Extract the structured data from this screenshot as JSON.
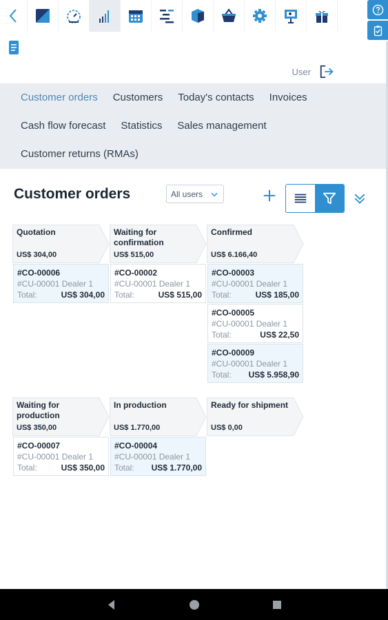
{
  "header": {
    "user_label": "User"
  },
  "nav": {
    "row1": [
      "Customer orders",
      "Customers",
      "Today's contacts",
      "Invoices"
    ],
    "row2": [
      "Cash flow forecast",
      "Statistics",
      "Sales management"
    ],
    "row3": [
      "Customer returns (RMAs)"
    ]
  },
  "page": {
    "title": "Customer orders",
    "user_filter": "All users"
  },
  "stages": [
    {
      "name": "Quotation",
      "total": "US$ 304,00",
      "cards": [
        {
          "id": "#CO-00006",
          "customer": "#CU-00001 Dealer 1",
          "total_label": "Total:",
          "total": "US$ 304,00",
          "highlighted": true
        }
      ]
    },
    {
      "name": "Waiting for confirmation",
      "total": "US$ 515,00",
      "cards": [
        {
          "id": "#CO-00002",
          "customer": "#CU-00001 Dealer 1",
          "total_label": "Total:",
          "total": "US$ 515,00",
          "highlighted": false
        }
      ]
    },
    {
      "name": "Confirmed",
      "total": "US$ 6.166,40",
      "cards": [
        {
          "id": "#CO-00003",
          "customer": "#CU-00001 Dealer 1",
          "total_label": "Total:",
          "total": "US$ 185,00",
          "highlighted": true
        },
        {
          "id": "#CO-00005",
          "customer": "#CU-00001 Dealer 1",
          "total_label": "Total:",
          "total": "US$ 22,50",
          "highlighted": false
        },
        {
          "id": "#CO-00009",
          "customer": "#CU-00001 Dealer 1",
          "total_label": "Total:",
          "total": "US$ 5.958,90",
          "highlighted": true
        }
      ]
    },
    {
      "name": "Waiting for production",
      "total": "US$ 350,00",
      "cards": [
        {
          "id": "#CO-00007",
          "customer": "#CU-00001 Dealer 1",
          "total_label": "Total:",
          "total": "US$ 350,00",
          "highlighted": false
        }
      ]
    },
    {
      "name": "In production",
      "total": "US$ 1.770,00",
      "cards": [
        {
          "id": "#CO-00004",
          "customer": "#CU-00001 Dealer 1",
          "total_label": "Total:",
          "total": "US$ 1.770,00",
          "highlighted": true
        }
      ]
    },
    {
      "name": "Ready for shipment",
      "total": "US$ 0,00",
      "cards": []
    }
  ],
  "colors": {
    "accent": "#2f8fd0",
    "nav_bg": "#e9edf1",
    "card_highlight": "#eef6fd",
    "active_nav": "#4e86b9"
  },
  "icons": [
    "back-icon",
    "marketing-icon",
    "dashboard-icon",
    "sales-icon",
    "calendar-icon",
    "projects-icon",
    "products-icon",
    "purchase-icon",
    "settings-icon",
    "presentation-icon",
    "gift-icon",
    "documents-icon",
    "help-icon",
    "tasks-icon",
    "logout-icon",
    "add-icon",
    "list-view-icon",
    "filter-icon",
    "expand-icon"
  ]
}
